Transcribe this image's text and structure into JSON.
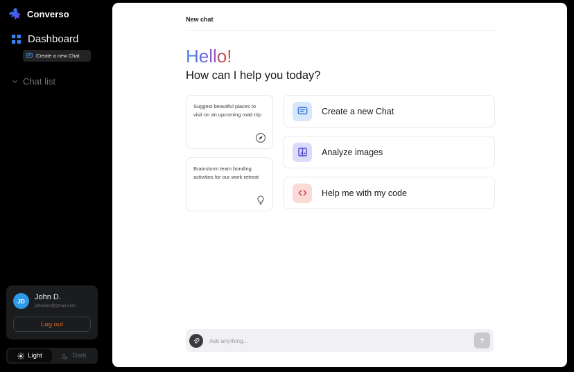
{
  "brand": {
    "name": "Converso",
    "logo_icon": "lightning-bolt-logo"
  },
  "sidebar": {
    "dashboard": {
      "label": "Dashboard",
      "icon": "grid-icon"
    },
    "new_chat_button": {
      "label": "Create a new Chat",
      "icon": "chat-bubble-icon"
    },
    "chat_list": {
      "label": "Chat list",
      "icon": "chevron-down-icon"
    },
    "user": {
      "initials": "JD",
      "name": "John D.",
      "email": "johndoe@gmail.com",
      "logout_label": "Log out",
      "logout_color": "#e06a2b",
      "avatar_color": "#2d9ae8"
    },
    "theme": {
      "light_label": "Light",
      "dark_label": "Dark",
      "light_icon": "sun-icon",
      "dark_icon": "moon-icon",
      "active": "Light"
    }
  },
  "main": {
    "header_title": "New chat",
    "greeting": "Hello!",
    "subtitle": "How can I help you today?",
    "greeting_gradient": [
      "#4285F4",
      "#8d5ad0",
      "#f3402e"
    ],
    "suggestions": [
      {
        "text": "Suggest beautiful places to visit on an upcoming road trip",
        "icon": "compass-icon"
      },
      {
        "text": "Brainstorm team bonding activities for our work retreat",
        "icon": "lightbulb-icon"
      }
    ],
    "actions": [
      {
        "label": "Create a new Chat",
        "icon": "chat-bubble-icon",
        "tile_bg": "#d6e7fb",
        "icon_color": "#2f6fd0"
      },
      {
        "label": "Analyze images",
        "icon": "image-icon",
        "tile_bg": "#dcdcfa",
        "icon_color": "#4a45c9"
      },
      {
        "label": "Help me with my code",
        "icon": "code-icon",
        "tile_bg": "#fad9d6",
        "icon_color": "#d8453c"
      }
    ],
    "input": {
      "placeholder": "Ask anything...",
      "value": "",
      "attach_icon": "paperclip-icon",
      "send_icon": "arrow-up-icon"
    }
  }
}
